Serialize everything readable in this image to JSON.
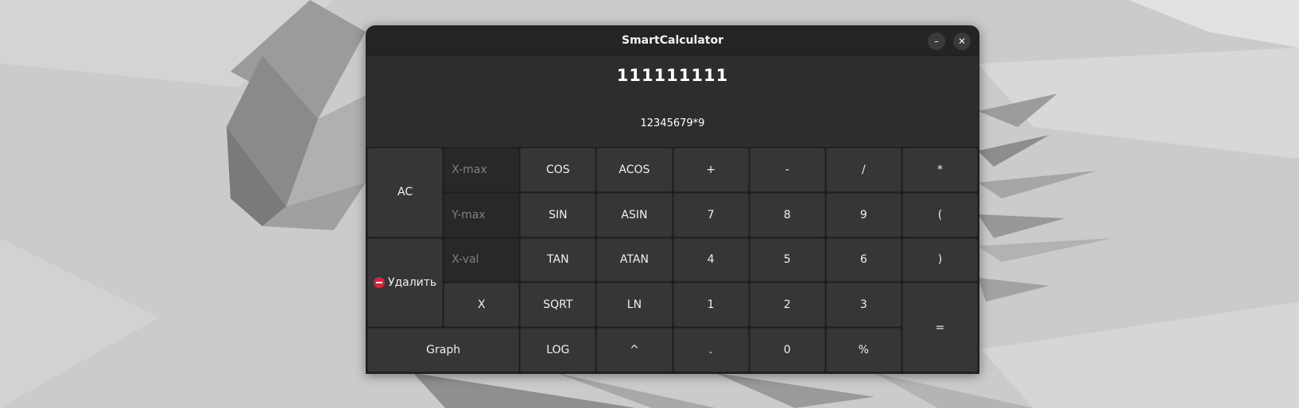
{
  "window": {
    "title": "SmartCalculator",
    "minimize_label": "–",
    "close_label": "✕"
  },
  "display": {
    "result": "111111111",
    "expression": "12345679*9"
  },
  "fields": {
    "x_max_placeholder": "X-max",
    "y_max_placeholder": "Y-max",
    "x_val_placeholder": "X-val"
  },
  "keys": {
    "ac": "AC",
    "delete": "Удалить",
    "x": "X",
    "graph": "Graph",
    "cos": "COS",
    "sin": "SIN",
    "tan": "TAN",
    "sqrt": "SQRT",
    "log": "LOG",
    "acos": "ACOS",
    "asin": "ASIN",
    "atan": "ATAN",
    "ln": "LN",
    "pow": "^",
    "plus": "+",
    "minus": "-",
    "divide": "/",
    "multiply": "*",
    "seven": "7",
    "eight": "8",
    "nine": "9",
    "lparen": "(",
    "four": "4",
    "five": "5",
    "six": "6",
    "rparen": ")",
    "one": "1",
    "two": "2",
    "three": "3",
    "equals": "=",
    "dot": ".",
    "zero": "0",
    "percent": "%"
  },
  "colors": {
    "window_bg": "#2d2d2d",
    "titlebar_bg": "#242424",
    "key_bg": "#363636",
    "delete_icon": "#d0253a"
  }
}
